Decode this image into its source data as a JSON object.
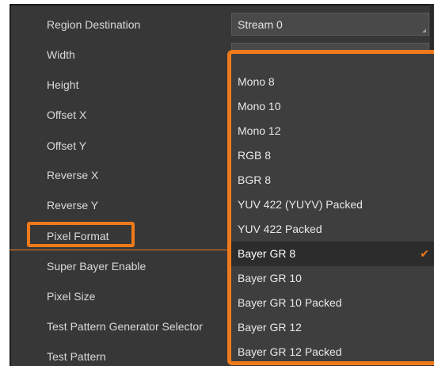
{
  "properties": {
    "rows": [
      {
        "label": "Region Destination"
      },
      {
        "label": "Width"
      },
      {
        "label": "Height"
      },
      {
        "label": "Offset X"
      },
      {
        "label": "Offset Y"
      },
      {
        "label": "Reverse X"
      },
      {
        "label": "Reverse Y"
      },
      {
        "label": "Pixel Format"
      },
      {
        "label": "Super Bayer Enable"
      },
      {
        "label": "Pixel Size"
      },
      {
        "label": "Test Pattern Generator Selector"
      },
      {
        "label": "Test Pattern"
      }
    ],
    "region_destination_value": "Stream 0"
  },
  "pixel_format_dropdown": {
    "options": [
      {
        "label": "Mono 8"
      },
      {
        "label": "Mono 10"
      },
      {
        "label": "Mono 12"
      },
      {
        "label": "RGB 8"
      },
      {
        "label": "BGR 8"
      },
      {
        "label": "YUV 422 (YUYV) Packed"
      },
      {
        "label": "YUV 422 Packed"
      },
      {
        "label": "Bayer GR 8",
        "selected": true
      },
      {
        "label": "Bayer GR 10"
      },
      {
        "label": "Bayer GR 10 Packed"
      },
      {
        "label": "Bayer GR 12"
      },
      {
        "label": "Bayer GR 12 Packed"
      }
    ],
    "selected_value": "Bayer GR 8",
    "check_symbol": "✔"
  },
  "colors": {
    "highlight": "#f07a1a",
    "panel_background": "#373737",
    "dropdown_background": "#3e3e3e",
    "selected_option_background": "#2c2c2c"
  }
}
